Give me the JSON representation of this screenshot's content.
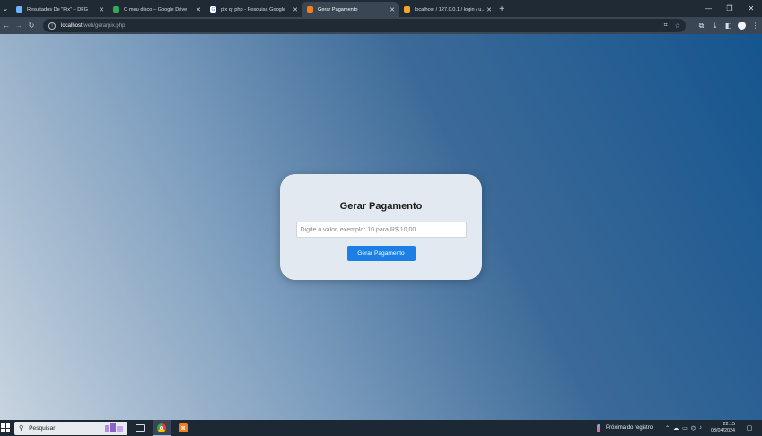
{
  "tabs": [
    {
      "title": "Resultados De \"Pix\" – DFG",
      "favicon_color": "#6fb2ff",
      "active": false
    },
    {
      "title": "O meu disco – Google Drive",
      "favicon_color": "#34a853",
      "active": false
    },
    {
      "title": "pix qr php - Pesquisa Google",
      "favicon_color": "#ffffff",
      "active": false
    },
    {
      "title": "Gerar Pagamento",
      "favicon_color": "#f57f1f",
      "active": true
    },
    {
      "title": "localhost / 127.0.0.1 / login / u...",
      "favicon_color": "#f5a623",
      "active": false
    }
  ],
  "address_bar": {
    "host": "localhost",
    "path": "/web/gerarpix.php"
  },
  "card": {
    "title": "Gerar Pagamento",
    "input_placeholder": "Digite o valor, exemplo: 10 para R$ 10,00",
    "button_label": "Gerar Pagamento"
  },
  "taskbar": {
    "search_placeholder": "Pesquisar",
    "weather_text": "Próxima do registro",
    "time": "22:15",
    "date": "08/04/2024"
  },
  "colors": {
    "accent": "#1b7fe6",
    "card_bg": "#e3e9f0"
  }
}
